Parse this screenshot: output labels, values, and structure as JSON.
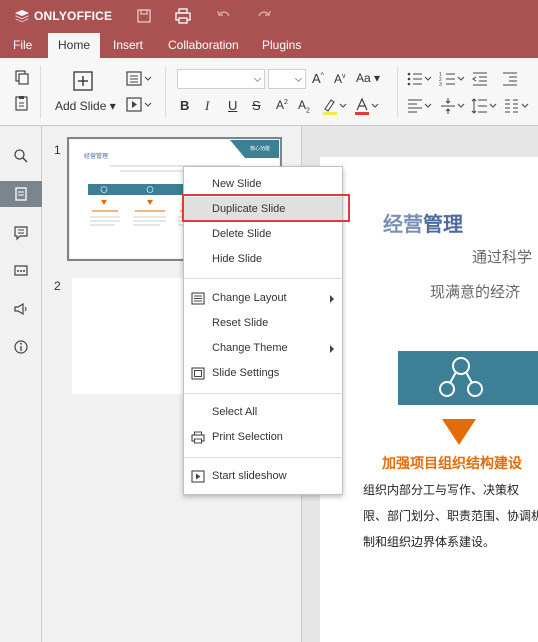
{
  "app": {
    "name": "ONLYOFFICE"
  },
  "tabs": [
    {
      "label": "File"
    },
    {
      "label": "Home"
    },
    {
      "label": "Insert"
    },
    {
      "label": "Collaboration"
    },
    {
      "label": "Plugins"
    }
  ],
  "toolbar": {
    "add_slide_label": "Add Slide",
    "font_name_value": "",
    "font_size_value": "",
    "change_case_label": "Aa"
  },
  "thumbnails": [
    {
      "number": "1",
      "title": "经营管理",
      "tag": "核心功能"
    },
    {
      "number": "2"
    }
  ],
  "context_menu": {
    "items": [
      {
        "label": "New Slide"
      },
      {
        "label": "Duplicate Slide"
      },
      {
        "label": "Delete Slide"
      },
      {
        "label": "Hide Slide"
      },
      {
        "label": "Change Layout"
      },
      {
        "label": "Reset Slide"
      },
      {
        "label": "Change Theme"
      },
      {
        "label": "Slide Settings"
      },
      {
        "label": "Select All"
      },
      {
        "label": "Print Selection"
      },
      {
        "label": "Start slideshow"
      }
    ]
  },
  "slide": {
    "title_gray": "经营",
    "title_blue": "管理",
    "subtitle_line1": "通过科学",
    "subtitle_line2": "现满意的经济",
    "section_heading_orange": "加强项目",
    "section_heading_blue": "组织结构建设",
    "body_line1": "组织内部分工与写作、决策权",
    "body_line2": "限、部门划分、职责范围、协调机",
    "body_line3": "制和组织边界体系建设。"
  },
  "colors": {
    "brand": "#aa5252",
    "slide_teal": "#3d7f94",
    "slide_orange": "#e36c09",
    "slide_blue": "#4f6b9c"
  }
}
